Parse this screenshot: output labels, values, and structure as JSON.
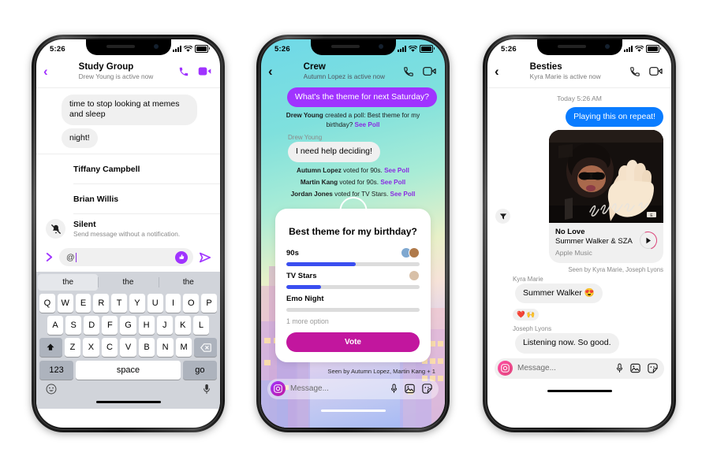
{
  "phones": [
    {
      "id": "study-group",
      "statusbar": {
        "time": "5:26",
        "signal_icon": "cellular-bars-icon",
        "wifi_icon": "wifi-icon",
        "battery_icon": "battery-full-icon"
      },
      "header": {
        "back_icon": "back-chevron-icon",
        "avatar": "group-avatar",
        "title": "Study Group",
        "subtitle": "Drew Young is active now",
        "call_icon": "phone-call-icon",
        "video_icon": "video-camera-icon",
        "accent": "#a033ff"
      },
      "messages": [
        {
          "text": "time to stop looking at memes and sleep",
          "side": "left",
          "style": "grey"
        },
        {
          "text": "night!",
          "side": "left",
          "style": "grey"
        }
      ],
      "mention_list": [
        {
          "name": "Tiffany Campbell",
          "sub": "",
          "icon": "avatar"
        },
        {
          "name": "Brian Willis",
          "sub": "",
          "icon": "avatar"
        },
        {
          "name": "Silent",
          "sub": "Send message without a notification.",
          "icon": "bell-slash-icon"
        }
      ],
      "composer": {
        "expand_icon": "chevron-right-icon",
        "value": "@",
        "like_icon": "thumbs-up-icon",
        "send_icon": "send-arrow-icon"
      },
      "keyboard": {
        "predictions": [
          "the",
          "the",
          "the"
        ],
        "selected_prediction_index": 0,
        "row1": [
          "Q",
          "W",
          "E",
          "R",
          "T",
          "Y",
          "U",
          "I",
          "O",
          "P"
        ],
        "row2": [
          "A",
          "S",
          "D",
          "F",
          "G",
          "H",
          "J",
          "K",
          "L"
        ],
        "row3_shift_icon": "shift-up-icon",
        "row3": [
          "Z",
          "X",
          "C",
          "V",
          "B",
          "N",
          "M"
        ],
        "row3_delete_icon": "backspace-icon",
        "numbers_key": "123",
        "space_key": "space",
        "return_key": "go",
        "emoji_icon": "smiley-face-icon",
        "dictation_icon": "microphone-icon"
      }
    },
    {
      "id": "crew",
      "statusbar": {
        "time": "5:26",
        "signal_icon": "cellular-bars-icon",
        "wifi_icon": "wifi-icon",
        "battery_icon": "battery-full-icon"
      },
      "header": {
        "back_icon": "back-chevron-icon",
        "avatar": "group-avatar",
        "title": "Crew",
        "subtitle": "Autumn Lopez is active now",
        "call_icon": "phone-call-icon",
        "video_icon": "video-camera-icon",
        "accent": "#050505"
      },
      "top_bubble": {
        "text": "What's the theme for next Saturday?",
        "style": "purple"
      },
      "poll_created": {
        "actor": "Drew Young",
        "text": " created a poll: Best theme for my birthday? ",
        "link": "See Poll"
      },
      "sender_label": "Drew Young",
      "reply_bubble": {
        "text": "I need help deciding!",
        "style": "grey"
      },
      "votes": [
        {
          "actor": "Autumn Lopez",
          "text": " voted for 90s. ",
          "link": "See Poll"
        },
        {
          "actor": "Martin Kang",
          "text": " voted for 90s. ",
          "link": "See Poll"
        },
        {
          "actor": "Jordan Jones",
          "text": " voted for TV Stars. ",
          "link": "See Poll"
        }
      ],
      "poll": {
        "avatar": "poll-author-avatar",
        "title": "Best theme for my birthday?",
        "options": [
          {
            "label": "90s",
            "fill_pct": 52,
            "voters": 2
          },
          {
            "label": "TV Stars",
            "fill_pct": 26,
            "voters": 1
          },
          {
            "label": "Emo Night",
            "fill_pct": 0,
            "voters": 0
          }
        ],
        "more_options": "1 more option",
        "vote_button": "Vote",
        "bar_color": "#3a4ef0",
        "button_color": "#c2169e"
      },
      "seen_by": "Seen by Autumn Lopez, Martin Kang + 1",
      "composer": {
        "camera_icon": "camera-icon",
        "placeholder": "Message...",
        "mic_icon": "microphone-icon",
        "gallery_icon": "photo-gallery-icon",
        "sticker_icon": "sticker-icon"
      }
    },
    {
      "id": "besties",
      "statusbar": {
        "time": "5:26",
        "signal_icon": "cellular-bars-icon",
        "wifi_icon": "wifi-icon",
        "battery_icon": "battery-full-icon"
      },
      "header": {
        "back_icon": "back-chevron-icon",
        "avatar": "group-avatar",
        "title": "Besties",
        "subtitle": "Kyra Marie is active now",
        "call_icon": "phone-call-icon",
        "video_icon": "video-camera-icon",
        "accent": "#050505"
      },
      "day_stamp": "Today 5:26 AM",
      "sent_bubble": {
        "text": "Playing this on repeat!",
        "style": "blue"
      },
      "music_card": {
        "album_caption": "Still Over It",
        "title": "No Love",
        "artist": "Summer Walker & SZA",
        "source": "Apple Music",
        "play_icon": "play-button-icon",
        "forward_icon": "forward-send-icon"
      },
      "seen_by": "Seen by Kyra Marie, Joseph Lyons",
      "thread": [
        {
          "sender": "Kyra Marie",
          "text": "Summer Walker 😍",
          "reactions": [
            "❤️",
            "🙌"
          ]
        },
        {
          "sender": "Joseph Lyons",
          "text": "Listening now. So good.",
          "reactions": []
        }
      ],
      "composer": {
        "camera_icon": "camera-icon",
        "placeholder": "Message...",
        "mic_icon": "microphone-icon",
        "gallery_icon": "photo-gallery-icon",
        "sticker_icon": "sticker-icon"
      }
    }
  ]
}
